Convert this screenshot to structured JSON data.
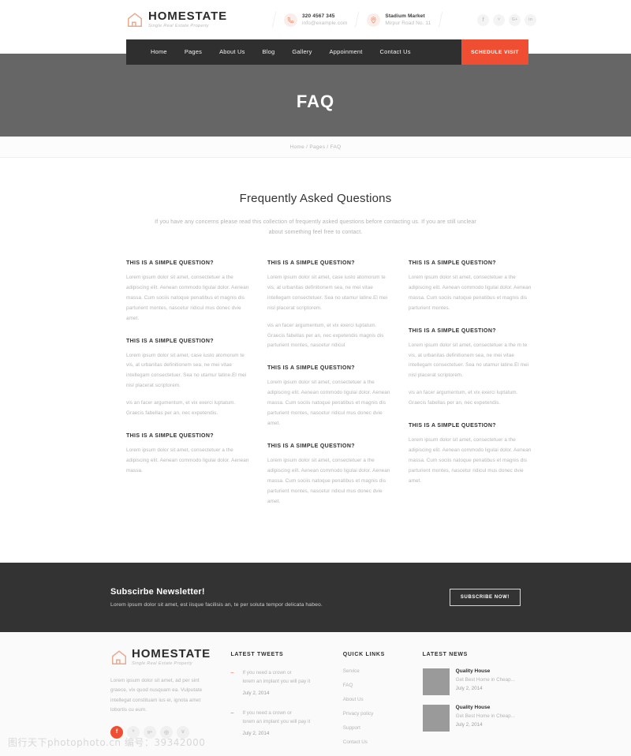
{
  "brand": {
    "name": "HOMESTATE",
    "tagline": "Single Real Estate Property",
    "icon": "house-icon"
  },
  "topbar": {
    "phone": {
      "icon": "phone-icon",
      "line1": "320 4567 345",
      "line2": "info@example.com"
    },
    "address": {
      "icon": "map-pin-icon",
      "line1": "Stadium Market",
      "line2": "Mirpur Road No. 11"
    },
    "socials": [
      {
        "name": "facebook-icon",
        "glyph": "f"
      },
      {
        "name": "twitter-icon",
        "glyph": "ᵛ"
      },
      {
        "name": "google-plus-icon",
        "glyph": "G+"
      },
      {
        "name": "linkedin-icon",
        "glyph": "in"
      }
    ]
  },
  "nav": {
    "items": [
      {
        "label": "Home"
      },
      {
        "label": "Pages"
      },
      {
        "label": "About Us"
      },
      {
        "label": "Blog"
      },
      {
        "label": "Gallery"
      },
      {
        "label": "Appoinment"
      },
      {
        "label": "Contact Us"
      }
    ],
    "cta_label": "SCHEDULE VISIT",
    "cta_color": "#f04e33",
    "bar_color": "#2f2f2f"
  },
  "hero": {
    "title": "FAQ",
    "bg_color": "#666666"
  },
  "breadcrumb": {
    "text": "Home  /  Pages  /  FAQ"
  },
  "faq": {
    "heading": "Frequently Asked Questions",
    "subheading": "If you have any concerns please read this collection of frequently asked questions before contacting us. If you are still unclear about something feel free to contact.",
    "columns": [
      {
        "items": [
          {
            "question": "THIS IS A SIMPLE QUESTION?",
            "paragraphs": [
              "Lorem ipsum dolor sit amet, consectetuer a the adipiscing elit. Aenean commodo ligulai dolor. Aenean massa. Cum sociis natoque penatibus et magnis dis parturient montes, nascetur ridicul mus donec dvie amet."
            ]
          },
          {
            "question": "THIS IS A SIMPLE QUESTION?",
            "paragraphs": [
              "Lorem ipsum dolor sit amet, case iusto atomorum te vis, at urbanitas definitionem sea, ne mei vitae intellegam consectetuer. Sea no utamur latine.El mei nisl placerat scriptorem.",
              "vis an facer argumentum, et vix exerci luptatum. Graecis fabellas per an, nec expetendis."
            ]
          },
          {
            "question": "THIS IS A SIMPLE QUESTION?",
            "paragraphs": [
              "Lorem ipsum dolor sit amet, consectetuer a the adipiscing elit. Aenean commodo ligulai dolor. Aenean massa."
            ]
          }
        ]
      },
      {
        "items": [
          {
            "question": "THIS IS A SIMPLE QUESTION?",
            "paragraphs": [
              "Lorem ipsum dolor sit amet, case iusto atomorum te vis, at urbanitas definitionem sea, ne mei vitae intellegam consectetuer. Sea no utamur latine.El mei nisl placerat scriptorem.",
              "vis an facer argumentum, et vix exerci luptatum. Graecis fabellas per an, nec expetendis magnis dis parturient montes, nascetur ridicul"
            ]
          },
          {
            "question": "THIS IS A SIMPLE QUESTION?",
            "paragraphs": [
              "Lorem ipsum dolor sit amet, consectetuer a the adipiscing elit. Aenean commodo ligulai dolor. Aenean massa. Cum sociis natoque penatibus et magnis dis parturient montes, nascetur ridicul mus donec dvie amet."
            ]
          },
          {
            "question": "THIS IS A SIMPLE QUESTION?",
            "paragraphs": [
              "Lorem ipsum dolor sit amet, consectetuer a the adipiscing elit. Aenean commodo ligulai dolor. Aenean massa. Cum sociis natoque penatibus et magnis dis parturient montes, nascetur ridicul mus donec dvie amet."
            ]
          }
        ]
      },
      {
        "items": [
          {
            "question": "THIS IS A SIMPLE QUESTION?",
            "paragraphs": [
              "Lorem ipsum dolor sit amet, consectetuer a the adipiscing elit. Aenean commodo ligulai dolor. Aenean massa. Cum sociis natoque penatibus et magnis dis parturient montes."
            ]
          },
          {
            "question": "THIS IS A SIMPLE QUESTION?",
            "paragraphs": [
              "Lorem ipsum dolor sit amet, consectetuer a the m te vis, at urbanitas definitionem sea, ne mei vitae intellegam consectetuer. Sea no utamur latine.El mei nisl placerat scriptorem.",
              "vis an facer argumentum, et vix exerci luptatum. Graecis fabellas per an, nec expetendis."
            ]
          },
          {
            "question": "THIS IS A SIMPLE QUESTION?",
            "paragraphs": [
              "Lorem ipsum dolor sit amet, consectetuer a the adipiscing elit. Aenean commodo ligulai dolor. Aenean massa. Cum sociis natoque penatibus et magnis dis parturient montes, nascetur ridicul mus donec dvie amet."
            ]
          }
        ]
      }
    ]
  },
  "newsletter": {
    "title": "Subscirbe Newsletter!",
    "subtitle": "Lorem ipsum dolor sit amet, est iisque facilisis an, te per soluta tempor delicata habeo.",
    "button_label": "SUBSCRIBE NOW!",
    "bg_color": "#333333"
  },
  "footer": {
    "about": {
      "text": "Lorem ipsum dolor sit amet, ad per sint graece, vix quod nusquam ea. Vulputate intellegat constituam ius ei, ignota amet lobortis cu eum.",
      "socials": [
        {
          "name": "facebook-icon",
          "glyph": "f",
          "active": true
        },
        {
          "name": "twitter-icon",
          "glyph": "ᵛ",
          "active": false
        },
        {
          "name": "google-plus-icon",
          "glyph": "g+",
          "active": false
        },
        {
          "name": "dribbble-icon",
          "glyph": "◎",
          "active": false
        },
        {
          "name": "vimeo-icon",
          "glyph": "v",
          "active": false
        }
      ]
    },
    "tweets": {
      "title": "LATEST TWEETS",
      "items": [
        {
          "line1": "If you need a crown or",
          "line2": "lorem an implant you will pay it",
          "date": "July 2, 2014"
        },
        {
          "line1": "If you need a crown or",
          "line2": "lorem an implant you will pay it",
          "date": "July 2, 2014"
        }
      ]
    },
    "quicklinks": {
      "title": "QUICK LINKS",
      "items": [
        {
          "label": "Service"
        },
        {
          "label": "FAQ"
        },
        {
          "label": "About Us"
        },
        {
          "label": "Privacy policy"
        },
        {
          "label": "Support"
        },
        {
          "label": "Contact Us"
        }
      ]
    },
    "latestnews": {
      "title": "LATEST NEWS",
      "items": [
        {
          "title": "Quality House",
          "desc": "Get Best Home in Cheap...",
          "date": "July 2, 2014"
        },
        {
          "title": "Quality House",
          "desc": "Get Best Home in Cheap...",
          "date": "July 2, 2014"
        }
      ]
    }
  },
  "watermark": {
    "text": "图行天下photophoto.cn  编号：39342000"
  }
}
